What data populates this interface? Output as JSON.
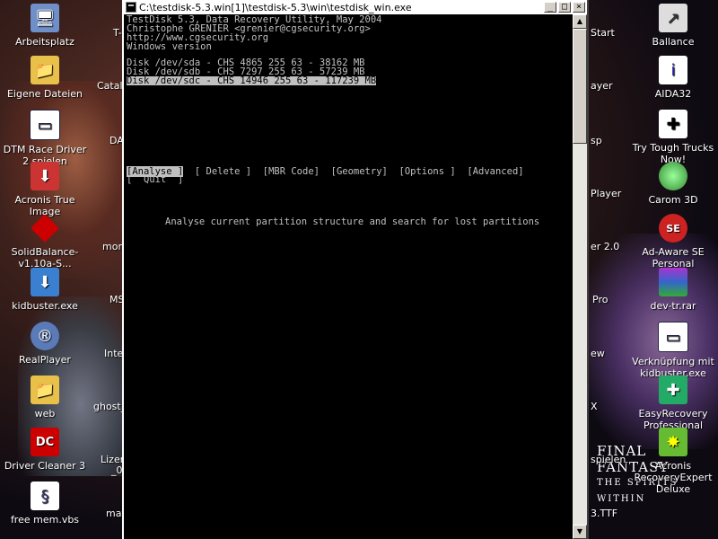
{
  "window": {
    "title": "C:\\testdisk-5.3.win[1]\\testdisk-5.3\\win\\testdisk_win.exe",
    "minimize": "_",
    "maximize": "□",
    "close": "×"
  },
  "console": {
    "header": [
      "TestDisk 5.3, Data Recovery Utility, May 2004",
      "Christophe GRENIER <grenier@cgsecurity.org>",
      "http://www.cgsecurity.org",
      "Windows version"
    ],
    "disks": [
      "Disk /dev/sda - CHS 4865 255 63 - 38162 MB",
      "Disk /dev/sdb - CHS 7297 255 63 - 57239 MB",
      "Disk /dev/sdc - CHS 14946 255 63 - 117239 MB"
    ],
    "menu": {
      "analyse": "[Analyse ]",
      "delete": "[ Delete ]",
      "mbr_code": "[MBR Code]",
      "geometry": "[Geometry]",
      "options": "[Options ]",
      "advanced": "[Advanced]",
      "quit": "[  Quit  ]"
    },
    "hint": "Analyse current partition structure and search for lost partitions"
  },
  "desktop_left": [
    {
      "label": "Arbeitsplatz",
      "icon": "computer-icon"
    },
    {
      "label": "Eigene Dateien",
      "icon": "folder-icon"
    },
    {
      "label": "DTM Race Driver 2 spielen",
      "icon": "app-window-icon"
    },
    {
      "label": "Acronis True Image",
      "icon": "installer-icon"
    },
    {
      "label": "SolidBalance-v1.10a-S...",
      "icon": "cube-icon"
    },
    {
      "label": "kidbuster.exe",
      "icon": "installer-icon"
    },
    {
      "label": "RealPlayer",
      "icon": "realplayer-icon"
    },
    {
      "label": "web",
      "icon": "folder-icon"
    },
    {
      "label": "Driver Cleaner 3",
      "icon": "dc-icon"
    },
    {
      "label": "free mem.vbs",
      "icon": "script-icon"
    }
  ],
  "desktop_mid": [
    {
      "label": "T-"
    },
    {
      "label": "Catalys"
    },
    {
      "label": "DA"
    },
    {
      "label": "mons"
    },
    {
      "label": "MS"
    },
    {
      "label": "Inter"
    },
    {
      "label": "ghost_re"
    },
    {
      "label": "Lizenz"
    },
    {
      "label": "_0"
    },
    {
      "label": "matr"
    }
  ],
  "desktop_right_partial": [
    {
      "label": "Start"
    },
    {
      "label": "ayer"
    },
    {
      "label": "sp"
    },
    {
      "label": "Player"
    },
    {
      "label": "er 2.0"
    },
    {
      "label": "Pro"
    },
    {
      "label": "ew"
    },
    {
      "label": "X"
    },
    {
      "label": "spielen"
    },
    {
      "label": "3.TTF"
    }
  ],
  "desktop_right": [
    {
      "label": "Ballance",
      "icon": "shortcut-icon"
    },
    {
      "label": "AIDA32",
      "icon": "shortcut-icon"
    },
    {
      "label": "Try Tough Trucks Now!",
      "icon": "shortcut-icon"
    },
    {
      "label": "Carom 3D",
      "icon": "carom-icon"
    },
    {
      "label": "Ad-Aware SE Personal",
      "icon": "adaware-icon"
    },
    {
      "label": "dev-tr.rar",
      "icon": "archive-icon"
    },
    {
      "label": "Verknüpfung mit kidbuster.exe",
      "icon": "app-window-icon"
    },
    {
      "label": "EasyRecovery Professional",
      "icon": "easyrecovery-icon"
    },
    {
      "label": "Acronis RecoveryExpert Deluxe",
      "icon": "acronis-icon"
    }
  ],
  "wallpaper": {
    "logo_line1": "FINAL FANTASY",
    "logo_line2": "THE SPIRITS WITHIN"
  }
}
